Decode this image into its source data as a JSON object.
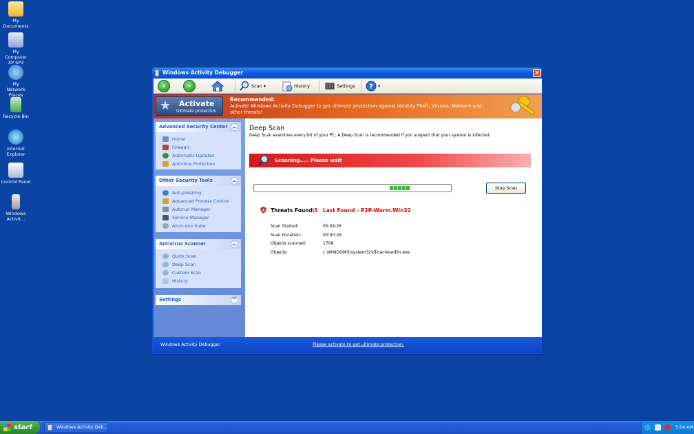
{
  "desktop": {
    "icons": [
      {
        "label": "My Documents",
        "icon": "folder-icon"
      },
      {
        "label": "My Computer XP SP3",
        "icon": "computer-icon"
      },
      {
        "label": "My Network Places",
        "icon": "network-icon"
      },
      {
        "label": "Recycle Bin",
        "icon": "recycle-bin-icon"
      },
      {
        "label": "Internet Explorer",
        "icon": "ie-icon"
      },
      {
        "label": "Control Panel",
        "icon": "control-panel-icon"
      },
      {
        "label": "Windows Activit...",
        "icon": "app-shortcut-icon"
      }
    ]
  },
  "window": {
    "title": "Windows Activity Debugger",
    "toolbar": {
      "scan_label": "Scan",
      "history_label": "History",
      "settings_label": "Settings"
    },
    "banner": {
      "activate_label": "Activate",
      "activate_sub": "Ultimate protection",
      "recommended_title": "Recommended:",
      "recommended_text": "Activate Windows Activity Debugger to get ultimate protection against Identity Theft, Viruses, Malware and other threats!"
    },
    "sidebar": {
      "panels": [
        {
          "title": "Advanced Security Center",
          "items": [
            "Home",
            "Firewall",
            "Automatic Updates",
            "Antivirus Protection"
          ]
        },
        {
          "title": "Other Security Tools",
          "items": [
            "Anti-phishing",
            "Advanced Process Control",
            "Autorun Manager",
            "Service Manager",
            "All-in-one Suite"
          ]
        },
        {
          "title": "Antivirus Scanner",
          "items": [
            "Quick Scan",
            "Deep Scan",
            "Custom Scan",
            "History"
          ]
        },
        {
          "title": "Settings",
          "items": []
        }
      ]
    },
    "main": {
      "heading": "Deep Scan",
      "description": "Deep Scan examines every bit of your PC. A Deep Scan is recommended if you suspect that your system is infected.",
      "scanning_text": "Scanning..... Please wait",
      "progress_fraction": 0.1,
      "stop_button": "Stop Scan",
      "threats_label": "Threats Found:",
      "threats_count": "3",
      "last_found": "Last Found - P2P-Worm.Win32",
      "stats": [
        {
          "label": "Scan Started:",
          "value": "05:04:26"
        },
        {
          "label": "Scan Duration:",
          "value": "00:00:26"
        },
        {
          "label": "Objects scanned:",
          "value": "1708"
        },
        {
          "label": "Objects:",
          "value": "c:\\WINDOWS\\system32\\dllcache\\edlin.exe"
        }
      ]
    },
    "status": {
      "left_text": "Windows Activity Debugger",
      "link_text": "Please activate to get ultimate protection."
    }
  },
  "taskbar": {
    "start_label": "start",
    "task_label": "Windows Activity Deb...",
    "clock": "5:04 AM"
  },
  "colors": {
    "desktop": "#0b44a3",
    "threat_red": "#e00000",
    "link_blue": "#215dc6"
  }
}
